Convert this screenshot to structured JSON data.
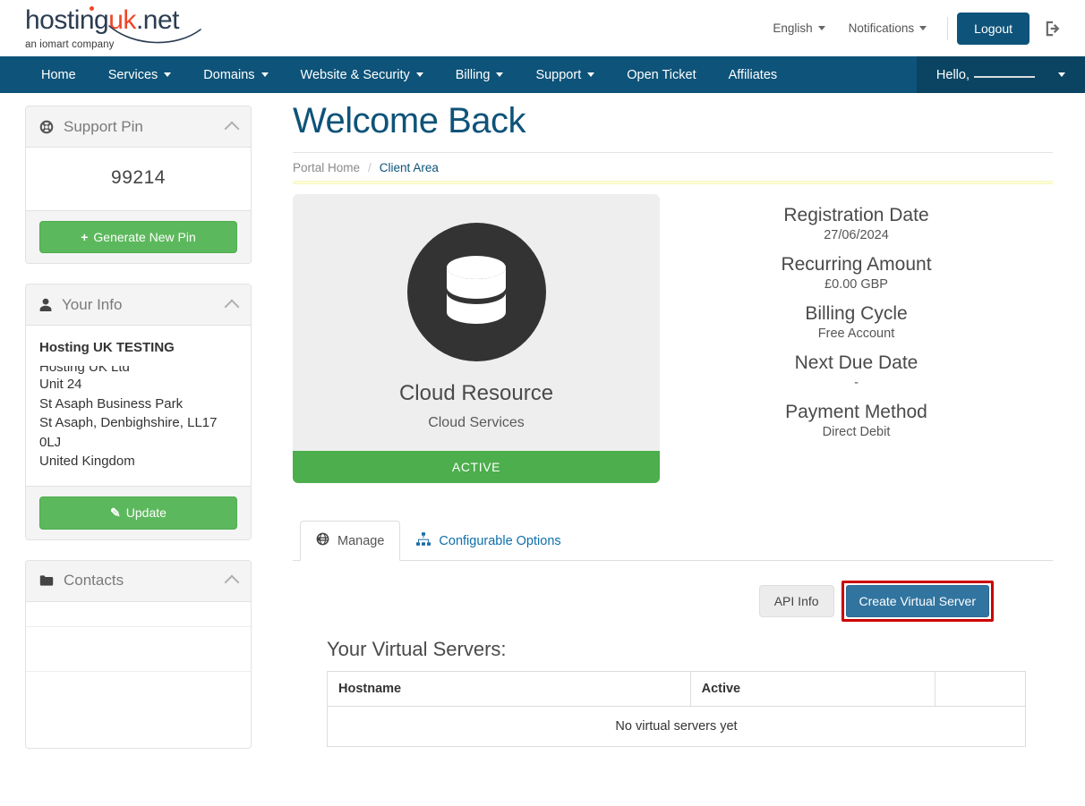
{
  "header": {
    "logo": {
      "part_a": "hosting",
      "part_b": "uk",
      "part_c": ".net",
      "tagline": "an iomart company"
    },
    "language_label": "English",
    "notifications_label": "Notifications",
    "logout_label": "Logout",
    "logout_icon": "sign-out-icon"
  },
  "nav": {
    "items": [
      {
        "label": "Home",
        "has_caret": false
      },
      {
        "label": "Services",
        "has_caret": true
      },
      {
        "label": "Domains",
        "has_caret": true
      },
      {
        "label": "Website & Security",
        "has_caret": true
      },
      {
        "label": "Billing",
        "has_caret": true
      },
      {
        "label": "Support",
        "has_caret": true
      },
      {
        "label": "Open Ticket",
        "has_caret": false
      },
      {
        "label": "Affiliates",
        "has_caret": false
      }
    ],
    "user_greeting": "Hello,",
    "bar_color": "#0e5379",
    "user_bg_color": "#0a4462"
  },
  "sidebar": {
    "support_pin": {
      "title": "Support Pin",
      "icon": "life-ring-icon",
      "pin": "99214",
      "button_label": "Generate New Pin",
      "button_icon": "plus-icon",
      "button_color": "#5cb85c"
    },
    "your_info": {
      "title": "Your Info",
      "icon": "user-icon",
      "company": "Hosting UK TESTING",
      "address_lines": [
        "Unit 24",
        "St Asaph Business Park",
        "St Asaph, Denbighshire, LL17 0LJ",
        "United Kingdom"
      ],
      "clipped_line": "Hosting UK Ltd",
      "button_label": "Update",
      "button_icon": "pencil-icon"
    },
    "contacts": {
      "title": "Contacts",
      "icon": "folder-icon"
    }
  },
  "main": {
    "page_title": "Welcome Back",
    "breadcrumb": {
      "home": "Portal Home",
      "separator": "/",
      "current": "Client Area"
    },
    "product": {
      "icon": "database-icon",
      "name": "Cloud Resource",
      "group": "Cloud Services",
      "status": "ACTIVE",
      "status_color": "#4cae4c"
    },
    "details": [
      {
        "label": "Registration Date",
        "value": "27/06/2024"
      },
      {
        "label": "Recurring Amount",
        "value": "£0.00 GBP"
      },
      {
        "label": "Billing Cycle",
        "value": "Free Account"
      },
      {
        "label": "Next Due Date",
        "value": "-"
      },
      {
        "label": "Payment Method",
        "value": "Direct Debit"
      }
    ],
    "tabs": [
      {
        "label": "Manage",
        "icon": "globe-icon",
        "active": true
      },
      {
        "label": "Configurable Options",
        "icon": "sitemap-icon",
        "active": false
      }
    ],
    "actions": {
      "api_info_label": "API Info",
      "create_server_label": "Create Virtual Server",
      "create_server_color": "#31749f",
      "highlight_color": "#cc0000"
    },
    "servers_section": {
      "title": "Your Virtual Servers:",
      "columns": [
        "Hostname",
        "Active",
        ""
      ],
      "empty_message": "No virtual servers yet",
      "rows": []
    }
  }
}
